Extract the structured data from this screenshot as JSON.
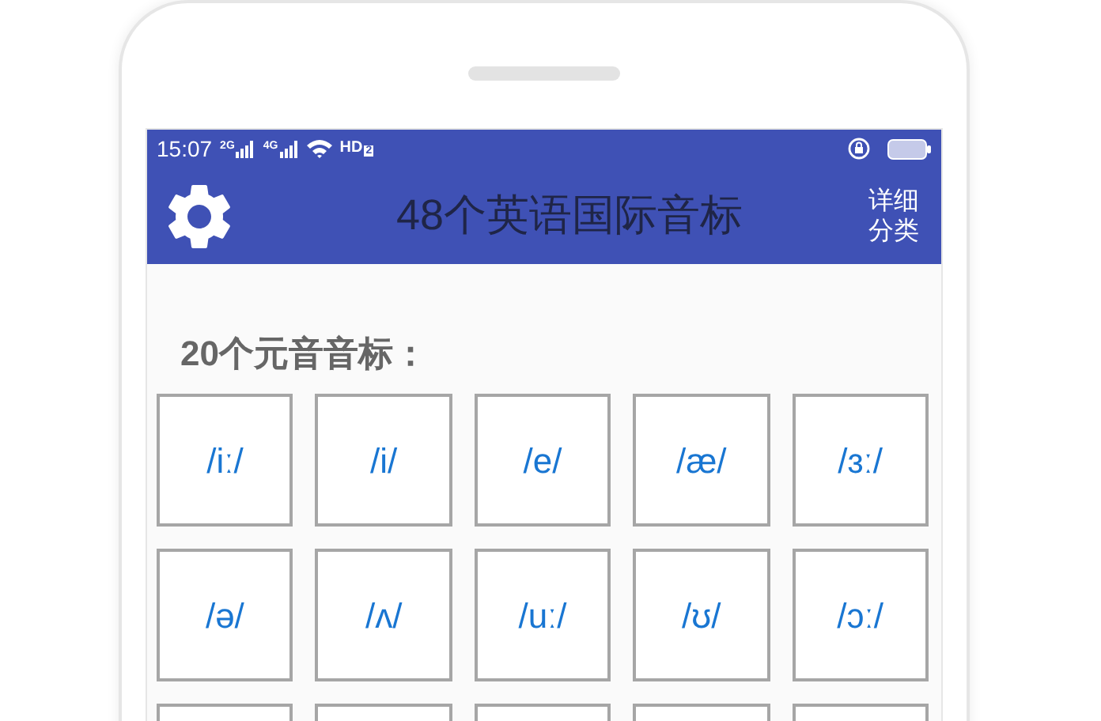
{
  "status_bar": {
    "time": "15:07",
    "signals": [
      {
        "label": "2G"
      },
      {
        "label": "4G"
      }
    ],
    "hd": {
      "label": "HD",
      "sub": "2"
    }
  },
  "app_bar": {
    "title": "48个英语国际音标",
    "action": {
      "lines": [
        "详细",
        "分类"
      ]
    }
  },
  "section": {
    "heading": "20个元音音标：",
    "cells": [
      {
        "kind": "symbol",
        "text": "/iː/"
      },
      {
        "kind": "symbol",
        "text": "/i/"
      },
      {
        "kind": "symbol",
        "text": "/e/"
      },
      {
        "kind": "symbol",
        "text": "/æ/"
      },
      {
        "kind": "symbol",
        "text": "/ɜː/"
      },
      {
        "kind": "symbol",
        "text": "/ə/"
      },
      {
        "kind": "symbol",
        "text": "/ʌ/"
      },
      {
        "kind": "symbol",
        "text": "/uː/"
      },
      {
        "kind": "symbol",
        "text": "/ʊ/"
      },
      {
        "kind": "symbol",
        "text": "/ɔː/"
      },
      {
        "kind": "hidden"
      },
      {
        "kind": "hidden"
      },
      {
        "kind": "hidden"
      },
      {
        "kind": "hidden"
      },
      {
        "kind": "hidden"
      }
    ]
  }
}
